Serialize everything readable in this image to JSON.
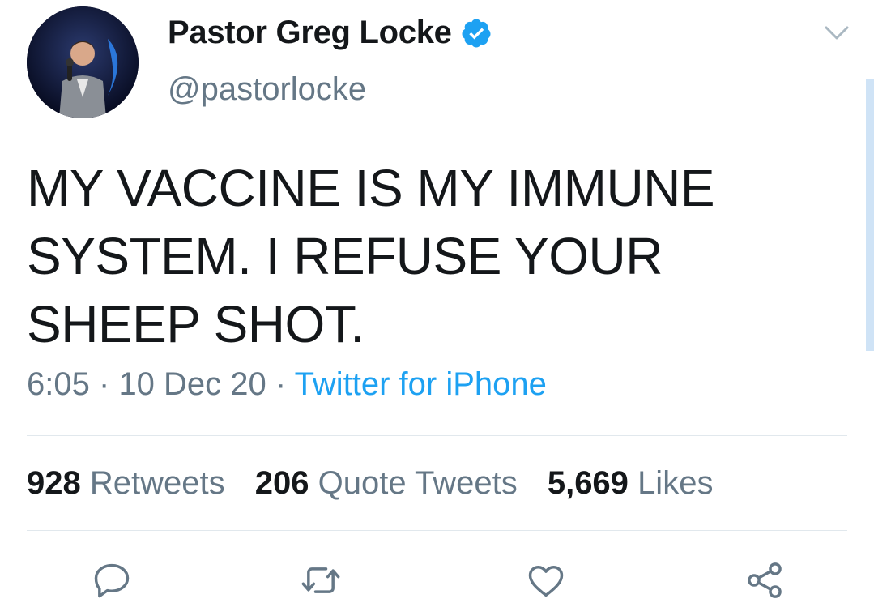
{
  "author": {
    "display_name": "Pastor Greg Locke",
    "handle": "@pastorlocke",
    "verified": true,
    "avatar_icon": "profile-photo"
  },
  "tweet": {
    "text": "MY VACCINE IS MY IMMUNE SYSTEM. I REFUSE YOUR SHEEP SHOT.",
    "time": "6:05",
    "separator": "·",
    "date": "10 Dec 20",
    "source": "Twitter for iPhone"
  },
  "stats": {
    "retweets_count": "928",
    "retweets_label": "Retweets",
    "quotes_count": "206",
    "quotes_label": "Quote Tweets",
    "likes_count": "5,669",
    "likes_label": "Likes"
  },
  "actions": [
    "reply-icon",
    "retweet-icon",
    "like-icon",
    "share-icon"
  ],
  "colors": {
    "accent": "#1da1f2",
    "text": "#14171a",
    "secondary": "#657786",
    "divider": "#e1e8ed"
  }
}
